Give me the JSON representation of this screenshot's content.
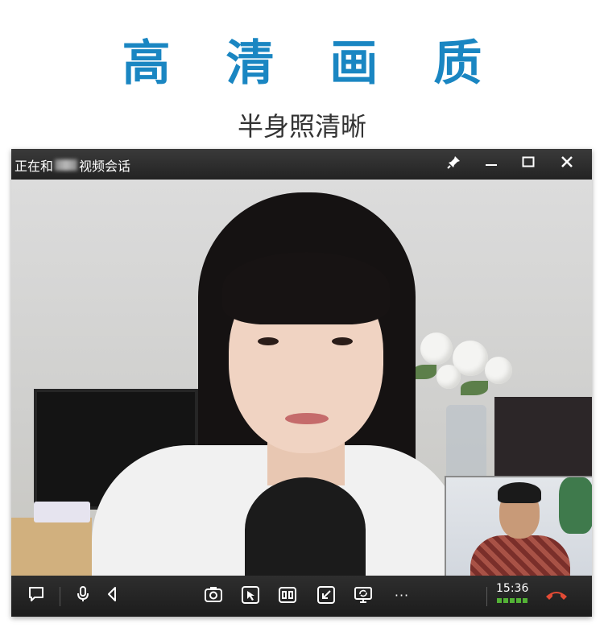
{
  "header": {
    "title": "高 清 画 质",
    "subtitle": "半身照清晰"
  },
  "window": {
    "title_prefix": "正在和",
    "title_suffix": "视频会话",
    "controls": {
      "pin": "✎",
      "minimize": "—",
      "maximize": "▭",
      "close": "✕"
    }
  },
  "toolbar": {
    "time": "15:36",
    "icons": [
      "chat-icon",
      "microphone-icon",
      "speaker-icon",
      "camera-icon",
      "screenshot-icon",
      "split-view-icon",
      "shrink-window-icon",
      "screen-share-icon",
      "more-icon",
      "hangup-icon"
    ],
    "more_label": "···"
  },
  "colors": {
    "headline": "#1a86c2",
    "subtitle": "#333333",
    "hangup": "#e34b35",
    "signal": "#53b236"
  }
}
